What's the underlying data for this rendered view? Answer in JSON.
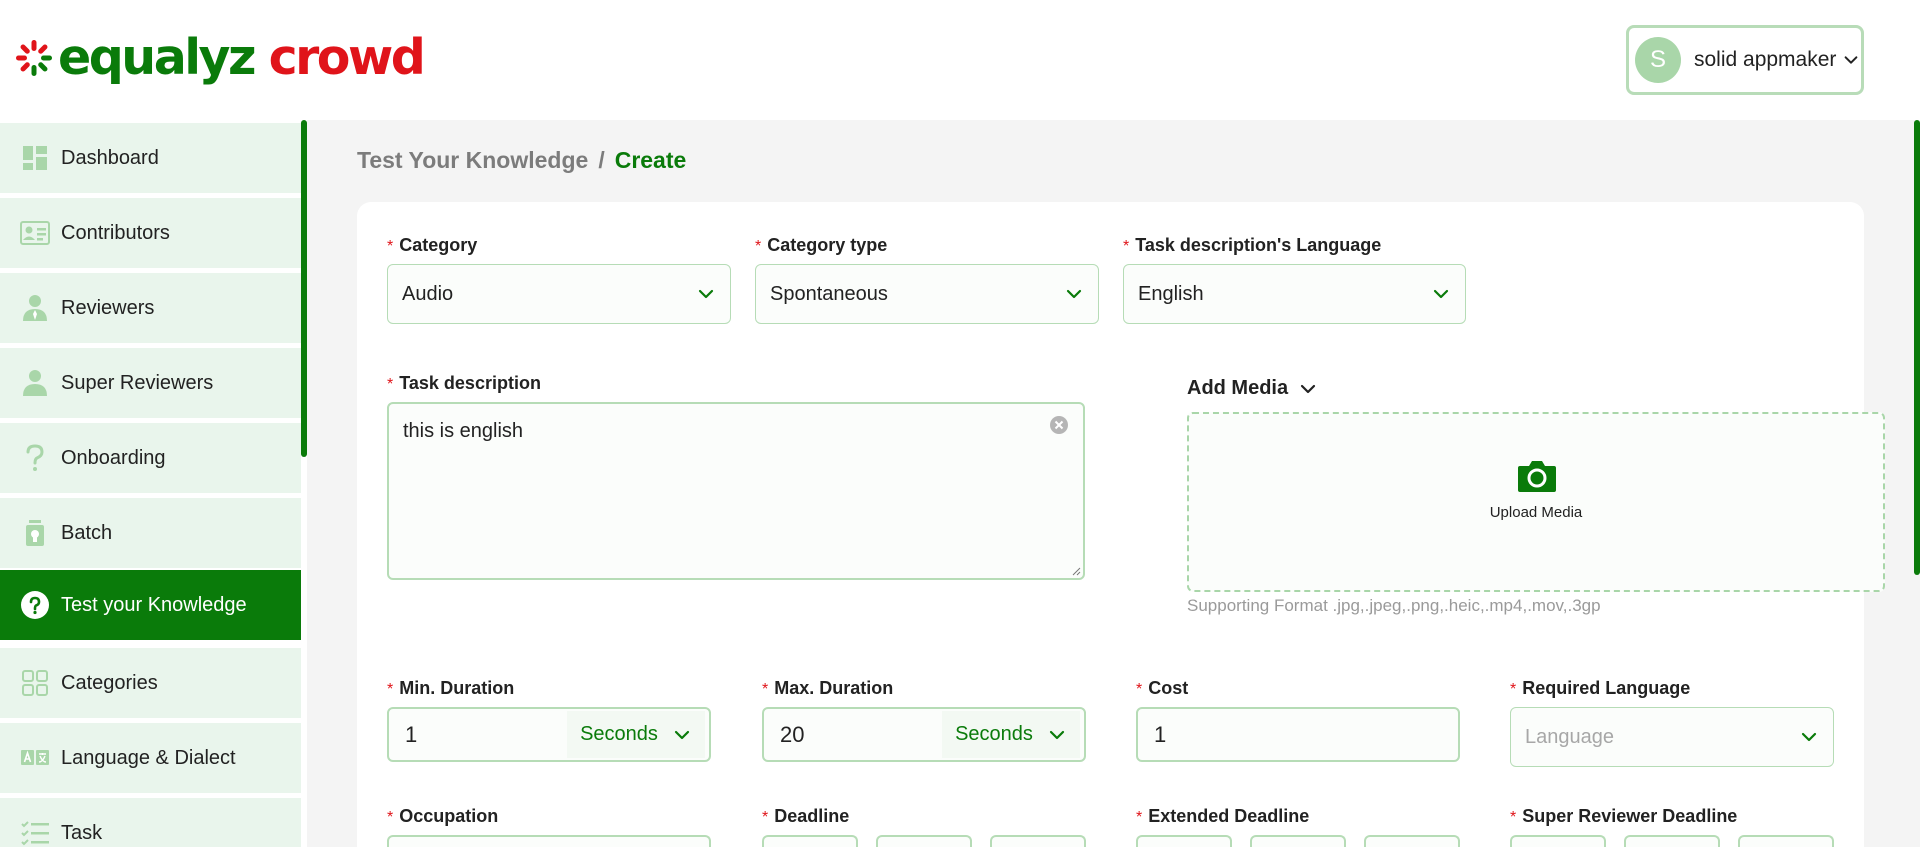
{
  "logo": {
    "part1": "equalyz",
    "part2": "crowd"
  },
  "user": {
    "initial": "S",
    "name": "solid appmaker"
  },
  "sidebar": {
    "items": [
      {
        "label": "Dashboard",
        "icon": "dashboard-icon"
      },
      {
        "label": "Contributors",
        "icon": "id-card-icon"
      },
      {
        "label": "Reviewers",
        "icon": "reviewer-icon"
      },
      {
        "label": "Super Reviewers",
        "icon": "person-icon"
      },
      {
        "label": "Onboarding",
        "icon": "question-mark-icon"
      },
      {
        "label": "Batch",
        "icon": "batch-icon"
      },
      {
        "label": "Test your Knowledge",
        "icon": "question-circle-icon",
        "active": true
      },
      {
        "label": "Categories",
        "icon": "categories-icon"
      },
      {
        "label": "Language & Dialect",
        "icon": "translate-icon"
      },
      {
        "label": "Task",
        "icon": "task-list-icon"
      }
    ]
  },
  "breadcrumb": {
    "parent": "Test Your Knowledge",
    "separator": "/",
    "current": "Create"
  },
  "form": {
    "required_mark": "*",
    "category": {
      "label": "Category",
      "value": "Audio"
    },
    "category_type": {
      "label": "Category type",
      "value": "Spontaneous"
    },
    "task_language": {
      "label": "Task description's Language",
      "value": "English"
    },
    "task_description": {
      "label": "Task description",
      "value": "this is english"
    },
    "add_media": {
      "label": "Add Media",
      "upload_label": "Upload Media",
      "support_text": "Supporting Format .jpg,.jpeg,.png,.heic,.mp4,.mov,.3gp"
    },
    "min_duration": {
      "label": "Min. Duration",
      "value": "1",
      "unit": "Seconds"
    },
    "max_duration": {
      "label": "Max. Duration",
      "value": "20",
      "unit": "Seconds"
    },
    "cost": {
      "label": "Cost",
      "value": "1"
    },
    "required_language": {
      "label": "Required Language",
      "placeholder": "Language"
    },
    "occupation": {
      "label": "Occupation"
    },
    "deadline": {
      "label": "Deadline"
    },
    "extended_deadline": {
      "label": "Extended Deadline"
    },
    "super_reviewer_deadline": {
      "label": "Super Reviewer Deadline"
    }
  },
  "colors": {
    "brand_green": "#0a7b0a",
    "brand_red": "#e0141a",
    "sidebar_bg": "#e9f5ec",
    "border_green": "#b6dcb6"
  }
}
